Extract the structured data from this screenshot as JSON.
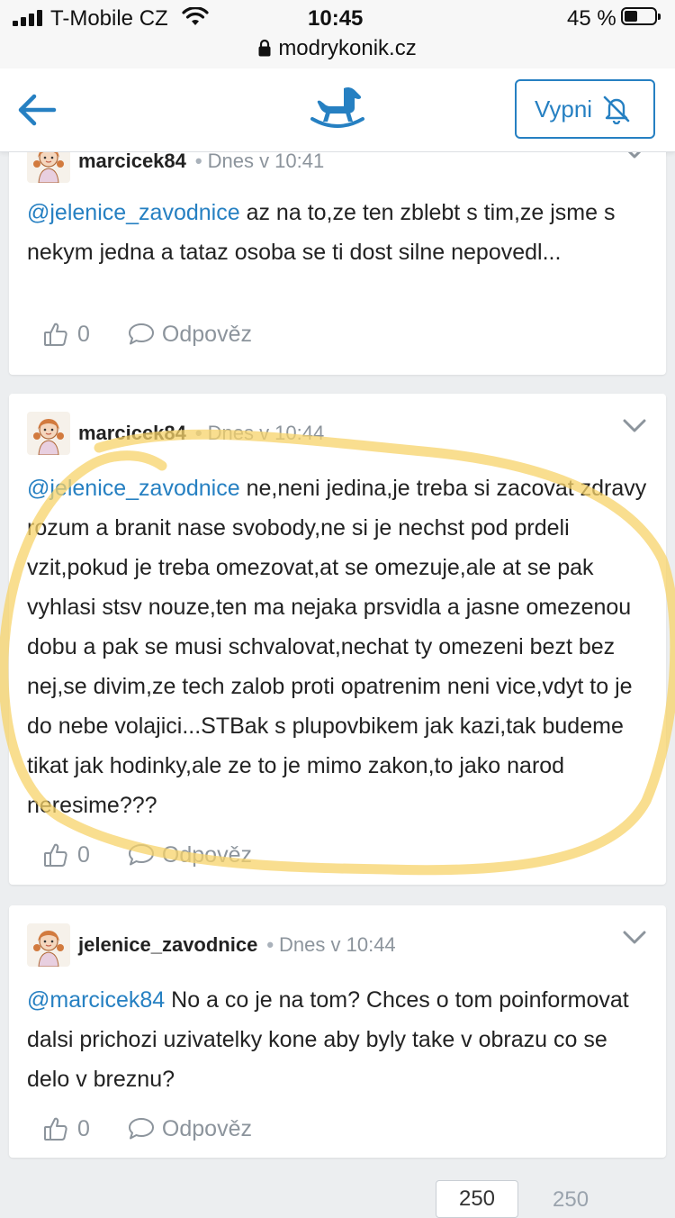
{
  "status_bar": {
    "carrier": "T-Mobile CZ",
    "time": "10:45",
    "battery_percent": "45 %",
    "battery_level": 0.45
  },
  "url_bar": {
    "domain": "modrykonik.cz"
  },
  "header": {
    "back_icon": "arrow-left-icon",
    "logo_icon": "rocking-horse-icon",
    "mute_button_label": "Vypni",
    "mute_icon": "bell-off-icon",
    "accent_color": "#2680c2"
  },
  "comments": [
    {
      "username": "marcicek84",
      "time": "Dnes v 10:41",
      "mention": "@jelenice_zavodnice",
      "text": " az na to,ze ten zblebt s tim,ze jsme s nekym jedna a tataz osoba se ti dost silne nepovedl...",
      "likes": "0",
      "reply_label": "Odpověz"
    },
    {
      "username": "marcicek84",
      "time": "Dnes v 10:44",
      "mention": "@jelenice_zavodnice",
      "text": " ne,neni jedina,je treba si zacovat zdravy rozum a branit nase svobody,ne si je nechst pod prdeli vzit,pokud je treba omezovat,at se omezuje,ale at se pak vyhlasi stsv nouze,ten ma nejaka prsvidla a jasne omezenou dobu a pak se musi schvalovat,nechat ty omezeni bezt bez nej,se divim,ze tech zalob proti opatrenim neni vice,vdyt to je do nebe volajici...STBak s plupovbikem jak kazi,tak budeme tikat jak hodinky,ale ze to je mimo zakon,to jako narod neresime???",
      "likes": "0",
      "reply_label": "Odpověz"
    },
    {
      "username": "jelenice_zavodnice",
      "time": "Dnes v 10:44",
      "mention": "@marcicek84",
      "text": " No a co je na tom? Chces o tom poinformovat dalsi prichozi uzivatelky kone aby byly take v obrazu co se delo v breznu?",
      "likes": "0",
      "reply_label": "Odpověz"
    }
  ],
  "highlight_color": "#f7d36a",
  "pagination": {
    "current_page": "250",
    "total_pages": "250"
  }
}
